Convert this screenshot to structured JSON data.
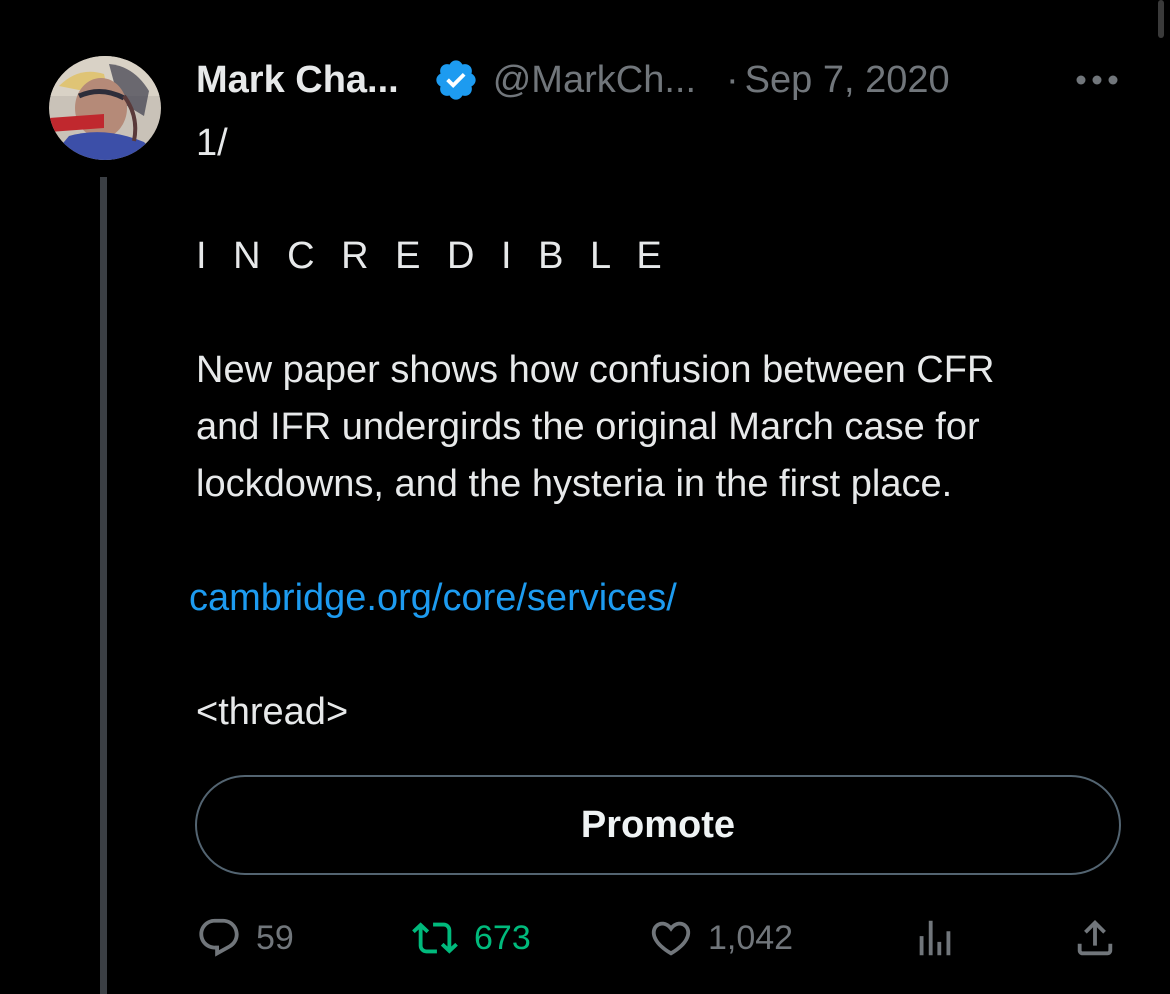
{
  "tweet": {
    "author": {
      "display_name": "Mark Cha...",
      "handle": "@MarkCh...",
      "verified": true,
      "avatar_icon": "user-avatar-painting"
    },
    "separator": "·",
    "date": "Sep 7, 2020",
    "body": {
      "line_index": "1/",
      "line_headline": "I N C R E D I B L E",
      "paragraph_lines": [
        "New paper shows how confusion between CFR",
        "and IFR undergirds the original March case for",
        "lockdowns, and the hysteria in the first place."
      ],
      "link": "cambridge.org/core/services/",
      "thread_tag": "<thread>"
    },
    "promote_label": "Promote",
    "stats": {
      "replies": "59",
      "retweets": "673",
      "likes": "1,042"
    }
  },
  "icons": {
    "verified": "verified-badge-icon",
    "more": "more-horizontal-icon",
    "reply": "reply-icon",
    "retweet": "retweet-icon",
    "like": "heart-icon",
    "views": "analytics-icon",
    "share": "share-icon"
  },
  "colors": {
    "background": "#000000",
    "text_primary": "#e7e9ea",
    "text_secondary": "#71767b",
    "link": "#1d9bf0",
    "verified": "#1d9bf0",
    "retweet_active": "#00ba7c",
    "thread_line": "#3b3f44",
    "button_border": "#536471"
  }
}
